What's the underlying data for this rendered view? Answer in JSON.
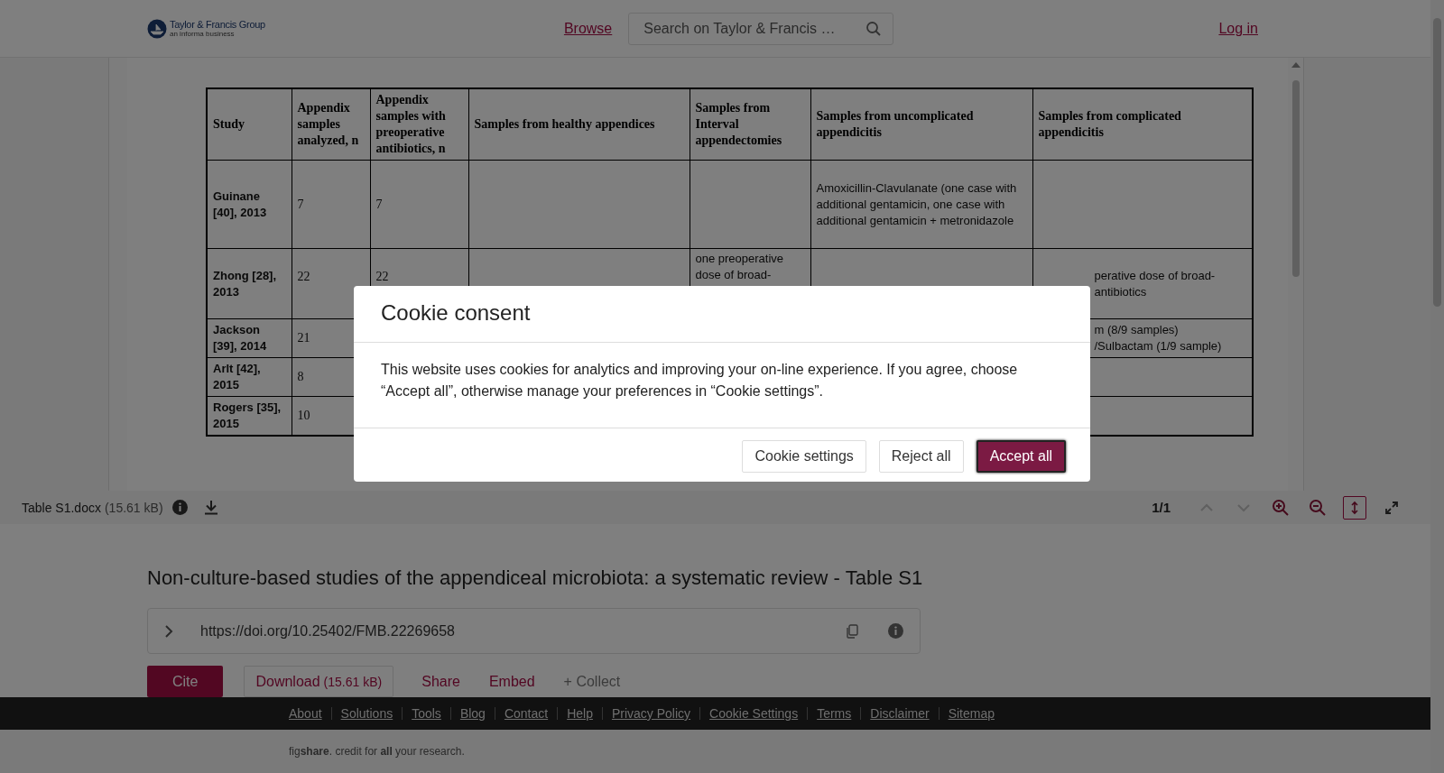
{
  "header": {
    "logo": {
      "name": "Taylor & Francis Group",
      "tagline": "an informa business"
    },
    "browse": "Browse",
    "search": {
      "placeholder": "Search on Taylor & Francis …"
    },
    "login": "Log in"
  },
  "document": {
    "columns": [
      "Study",
      "Appendix samples analyzed, n",
      "Appendix samples with preoperative antibiotics, n",
      "Samples from healthy appendices",
      "Samples from Interval appendectomies",
      "Samples from uncomplicated appendicitis",
      "Samples from complicated appendicitis"
    ],
    "rows": [
      {
        "cells": [
          "Guinane [40], 2013",
          "7",
          "7",
          null,
          null,
          "Amoxicillin-Clavulanate (one case with additional gentamicin, one case with additional gentamicin + metronidazole",
          null
        ]
      },
      {
        "cells": [
          "Zhong [28], 2013",
          "22",
          "22",
          null,
          "one preoperative dose of broad-",
          null,
          "perative dose of broad-\nantibiotics"
        ]
      },
      {
        "cells": [
          "Jackson [39], 2014",
          "21",
          null,
          null,
          null,
          null,
          "m (8/9 samples)\n/Sulbactam (1/9 sample)"
        ]
      },
      {
        "cells": [
          "Arlt [42], 2015",
          "8",
          null,
          null,
          null,
          null,
          null
        ]
      },
      {
        "cells": [
          "Rogers [35], 2015",
          "10",
          null,
          null,
          null,
          null,
          null
        ]
      }
    ]
  },
  "viewer_toolbar": {
    "file_name": "Table S1.docx",
    "file_size": "(15.61 kB)",
    "page": "1/1",
    "tools": [
      {
        "kind": "prev",
        "disabled": true,
        "selected": false
      },
      {
        "kind": "next",
        "disabled": true,
        "selected": false
      },
      {
        "kind": "zoom-in",
        "disabled": false,
        "selected": false
      },
      {
        "kind": "zoom-out",
        "disabled": false,
        "selected": false
      },
      {
        "kind": "fit-height",
        "disabled": false,
        "selected": true
      },
      {
        "kind": "fullscreen",
        "disabled": false,
        "selected": false
      }
    ]
  },
  "item": {
    "title": "Non-culture-based studies of the appendiceal microbiota: a systematic review - Table S1",
    "doi": "https://doi.org/10.25402/FMB.22269658",
    "actions": [
      {
        "kind": "primary",
        "label": "Cite"
      },
      {
        "kind": "outlined",
        "label": "Download",
        "note": "(15.61 kB)"
      },
      {
        "kind": "link",
        "label": "Share"
      },
      {
        "kind": "link",
        "label": "Embed"
      },
      {
        "kind": "muted",
        "label": "+ Collect"
      }
    ]
  },
  "footer": {
    "links": [
      "About",
      "Solutions",
      "Tools",
      "Blog",
      "Contact",
      "Help",
      "Privacy Policy",
      "Cookie Settings",
      "Terms",
      "Disclaimer",
      "Sitemap"
    ],
    "tagline": "fig**share**. credit for **all** your research."
  },
  "cookie_dialog": {
    "title": "Cookie consent",
    "body": "This website uses cookies for analytics and improving your on-line experience. If you agree, choose “Accept all”, otherwise manage your preferences in “Cookie settings”.",
    "buttons": [
      {
        "label": "Cookie settings",
        "kind": "secondary"
      },
      {
        "label": "Reject all",
        "kind": "secondary"
      },
      {
        "label": "Accept all",
        "kind": "primary"
      }
    ]
  }
}
